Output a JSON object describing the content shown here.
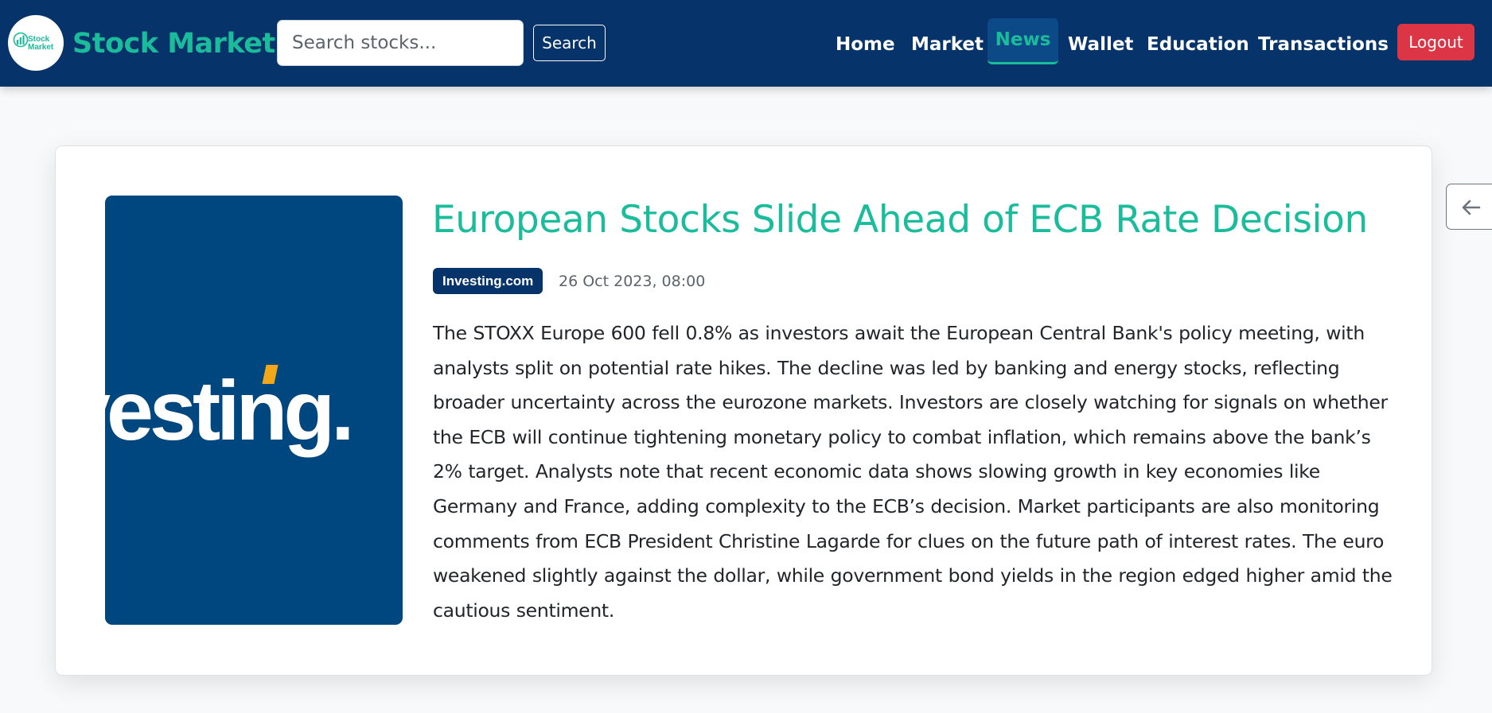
{
  "brand": {
    "logo_text_line1": "Stock",
    "logo_text_line2": "Market",
    "logo_icon": "stock-growth-icon",
    "name": "Stock Market"
  },
  "search": {
    "placeholder": "Search stocks...",
    "value": "",
    "button_label": "Search"
  },
  "nav": {
    "items": [
      {
        "label": "Home",
        "active": false
      },
      {
        "label": "Market",
        "active": false
      },
      {
        "label": "News",
        "active": true
      },
      {
        "label": "Wallet",
        "active": false
      },
      {
        "label": "Education",
        "active": false
      },
      {
        "label": "Transactions",
        "active": false
      }
    ],
    "logout_label": "Logout"
  },
  "article": {
    "image_wordmark": "vesting.",
    "title": "European Stocks Slide Ahead of ECB Rate Decision",
    "source": "Investing.com",
    "date": "26 Oct 2023, 08:00",
    "body": "The STOXX Europe 600 fell 0.8% as investors await the European Central Bank's policy meeting, with analysts split on potential rate hikes. The decline was led by banking and energy stocks, reflecting broader uncertainty across the eurozone markets. Investors are closely watching for signals on whether the ECB will continue tightening monetary policy to combat inflation, which remains above the bank’s 2% target. Analysts note that recent economic data shows slowing growth in key economies like Germany and France, adding complexity to the ECB’s decision. Market participants are also monitoring comments from ECB President Christine Lagarde for clues on the future path of interest rates. The euro weakened slightly against the dollar, while government bond yields in the region edged higher amid the cautious sentiment."
  },
  "back_button": {
    "icon": "arrow-left-icon"
  },
  "colors": {
    "navbar_bg": "#05336a",
    "accent": "#1abc9c",
    "logout": "#dc3545",
    "article_image_bg": "#00467f",
    "image_accent": "#f2a71b"
  }
}
